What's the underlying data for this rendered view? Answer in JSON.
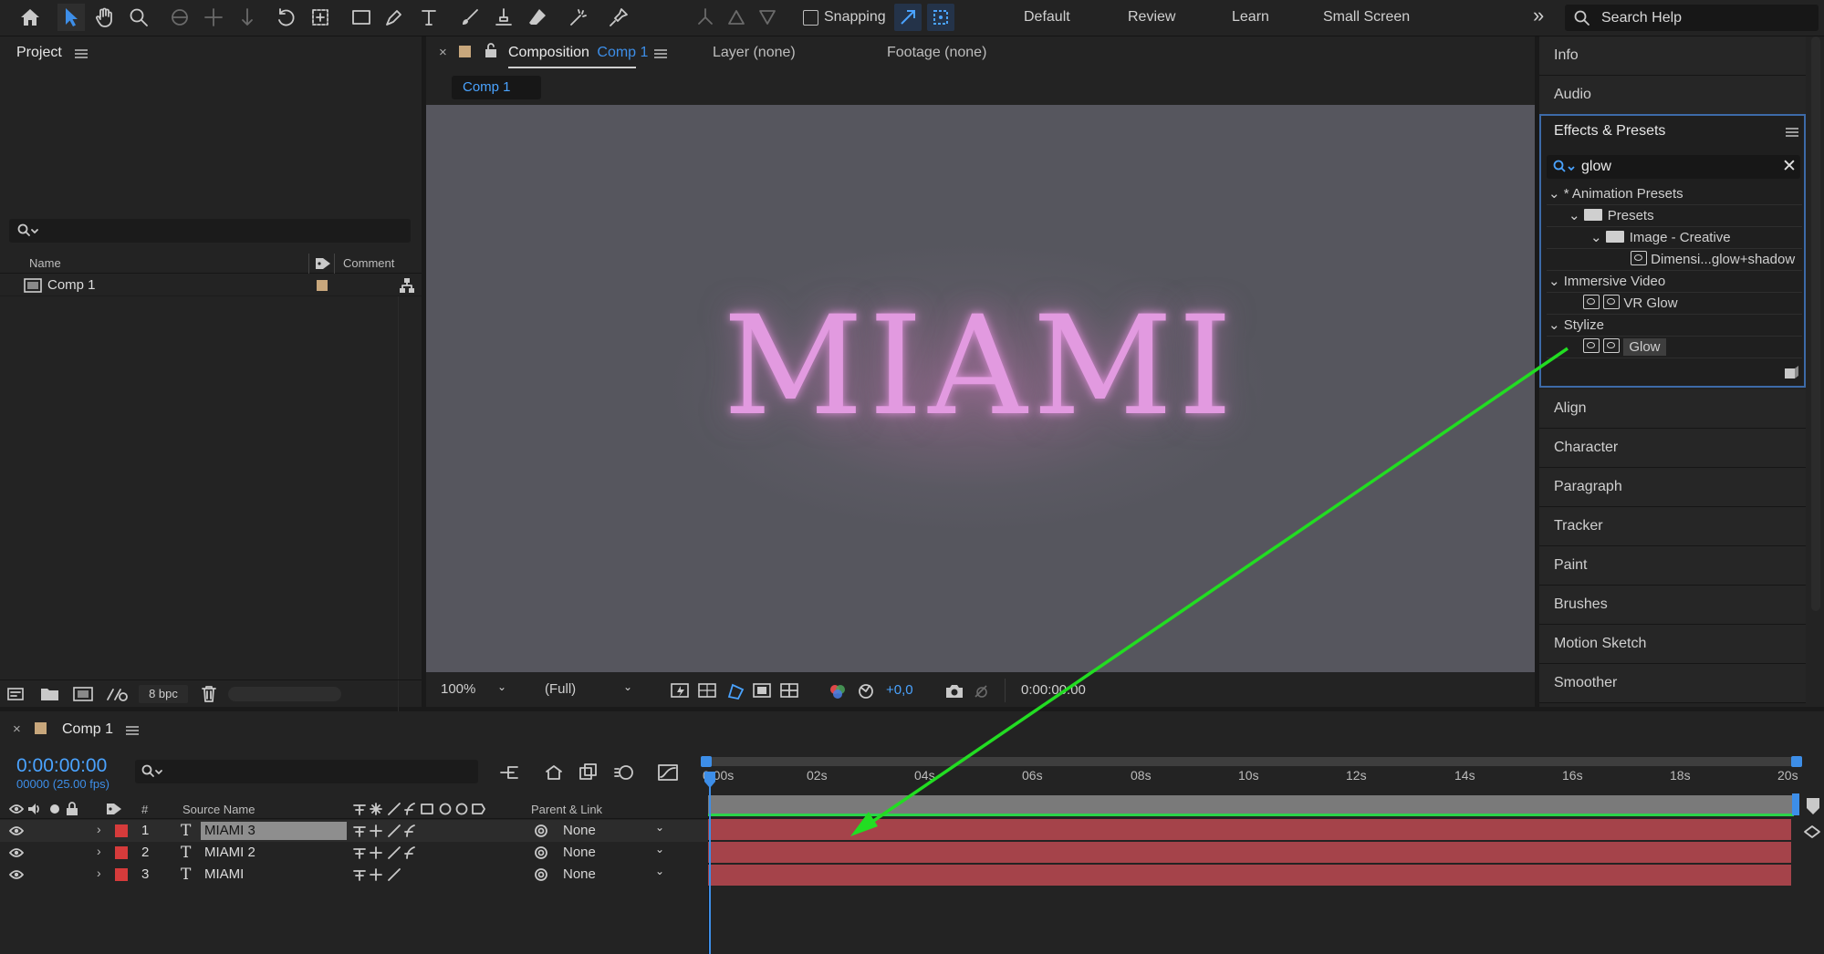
{
  "toolbar": {
    "snapping_label": "Snapping",
    "workspaces": [
      "Default",
      "Review",
      "Learn",
      "Small Screen"
    ],
    "overflow": "»",
    "search_placeholder": "Search Help"
  },
  "project": {
    "title": "Project",
    "columns": {
      "name": "Name",
      "comment": "Comment"
    },
    "items": [
      {
        "name": "Comp 1"
      }
    ],
    "bpc": "8 bpc"
  },
  "comp": {
    "tab_prefix": "Composition",
    "tab_name": "Comp 1",
    "layer_tab": "Layer (none)",
    "footage_tab": "Footage (none)",
    "subtab": "Comp 1",
    "viewer_text": "MIAMI",
    "zoom": "100%",
    "resolution": "(Full)",
    "exposure": "+0,0",
    "timecode": "0:00:00:00"
  },
  "right": {
    "top_items": [
      "Info",
      "Audio"
    ],
    "effects": {
      "title": "Effects & Presets",
      "search_value": "glow",
      "tree": {
        "animation_presets": "* Animation Presets",
        "presets": "Presets",
        "image_creative": "Image - Creative",
        "dimensional": "Dimensi...glow+shadow",
        "immersive": "Immersive Video",
        "vr_glow": "VR Glow",
        "stylize": "Stylize",
        "glow": "Glow"
      }
    },
    "bottom_items": [
      "Align",
      "Character",
      "Paragraph",
      "Tracker",
      "Paint",
      "Brushes",
      "Motion Sketch",
      "Smoother"
    ]
  },
  "timeline": {
    "tab_name": "Comp 1",
    "current_time": "0:00:00:00",
    "frame_info": "00000 (25.00 fps)",
    "columns": {
      "number": "#",
      "source": "Source Name",
      "parent": "Parent & Link"
    },
    "ruler": [
      "0:00s",
      "02s",
      "04s",
      "06s",
      "08s",
      "10s",
      "12s",
      "14s",
      "16s",
      "18s",
      "20s"
    ],
    "layers": [
      {
        "num": "1",
        "name": "MIAMI 3",
        "parent": "None"
      },
      {
        "num": "2",
        "name": "MIAMI 2",
        "parent": "None"
      },
      {
        "num": "3",
        "name": "MIAMI",
        "parent": "None"
      }
    ]
  },
  "colors": {
    "accent": "#3d8ee8",
    "label_red": "#d63b3b",
    "layer_bar": "#a5434a",
    "annotation": "#22dd22"
  }
}
